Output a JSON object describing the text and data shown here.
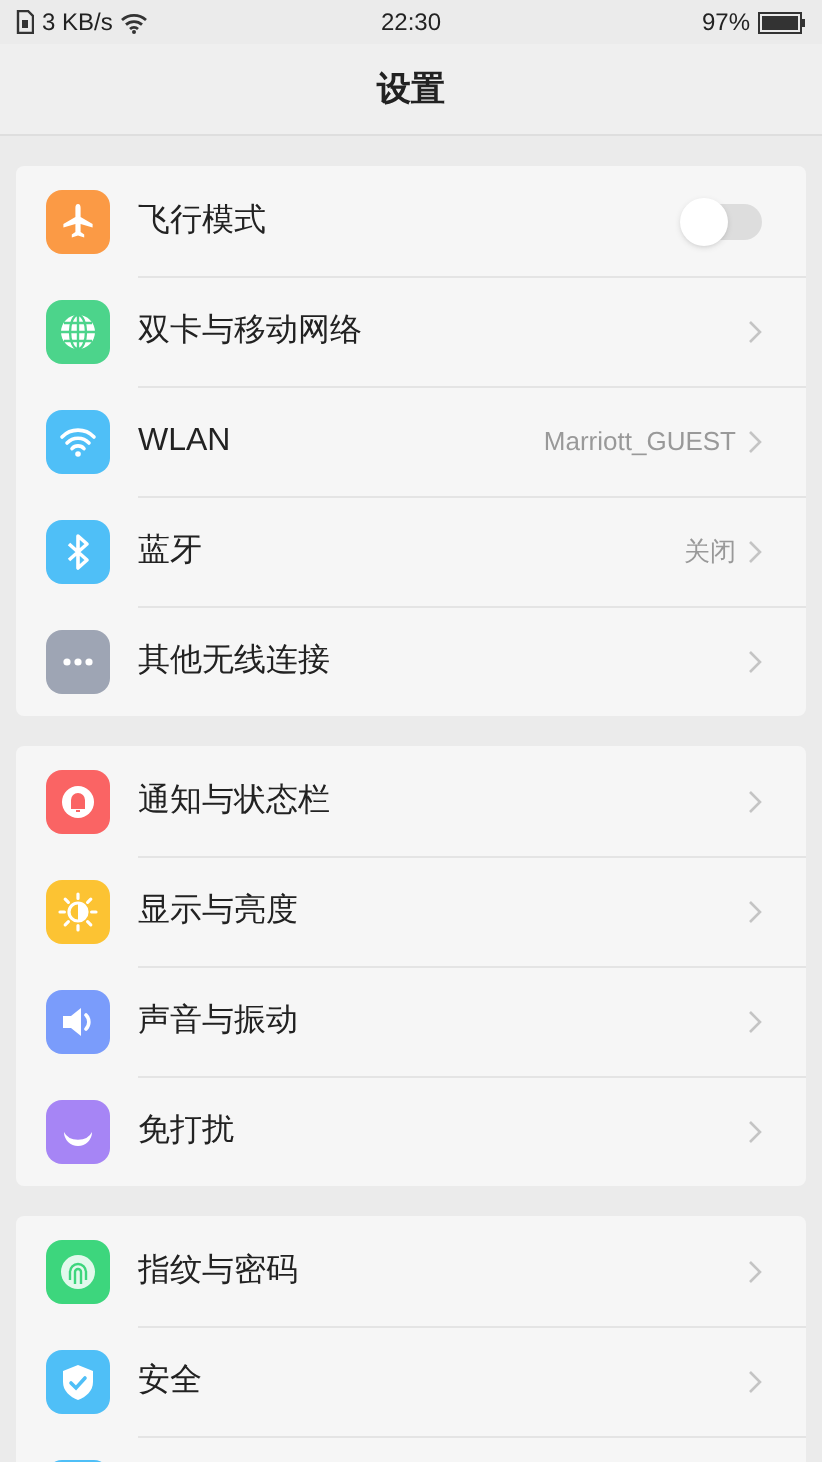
{
  "status_bar": {
    "speed": "3 KB/s",
    "time": "22:30",
    "battery": "97%"
  },
  "title": "设置",
  "sections": [
    {
      "items": [
        {
          "kind": "toggle",
          "label": "飞行模式",
          "color": "#fb9a45",
          "on": false
        },
        {
          "kind": "link",
          "label": "双卡与移动网络",
          "color": "#4cd48b"
        },
        {
          "kind": "link",
          "label": "WLAN",
          "value": "Marriott_GUEST",
          "color": "#4fbff7"
        },
        {
          "kind": "link",
          "label": "蓝牙",
          "value": "关闭",
          "color": "#4fbff7"
        },
        {
          "kind": "link",
          "label": "其他无线连接",
          "color": "#9ea5b4"
        }
      ]
    },
    {
      "items": [
        {
          "kind": "link",
          "label": "通知与状态栏",
          "color": "#fa6464"
        },
        {
          "kind": "link",
          "label": "显示与亮度",
          "color": "#fcc333"
        },
        {
          "kind": "link",
          "label": "声音与振动",
          "color": "#7a9cfb"
        },
        {
          "kind": "link",
          "label": "免打扰",
          "color": "#a685f5"
        }
      ]
    },
    {
      "items": [
        {
          "kind": "link",
          "label": "指纹与密码",
          "color": "#3dd67d"
        },
        {
          "kind": "link",
          "label": "安全",
          "color": "#4fbff7"
        },
        {
          "kind": "partial",
          "color": "#4fbff7"
        }
      ]
    }
  ]
}
